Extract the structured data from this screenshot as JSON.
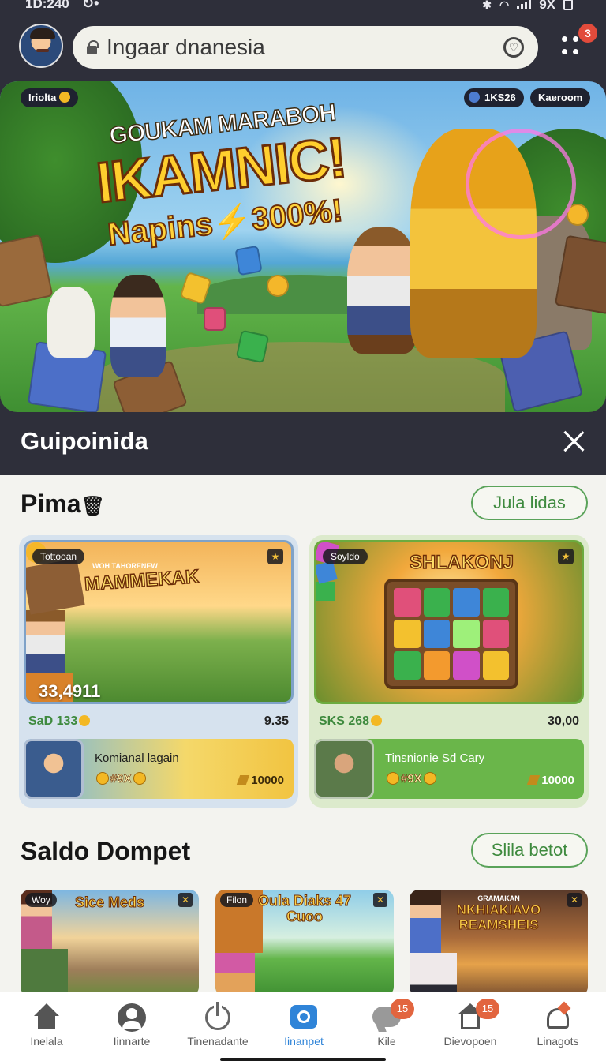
{
  "status_bar": {
    "time": "1D:240",
    "battery": "9X"
  },
  "search": {
    "text": "Ingaar dnanesia"
  },
  "menu": {
    "badge": "3"
  },
  "hero": {
    "chip_left": "Iriolta",
    "chip_right_1": "1KS26",
    "chip_right_2": "Kaeroom",
    "line1": "GOUKAM MARABOH",
    "line2": "IKAMNIC!",
    "line3": "Napins⚡300%!"
  },
  "game_title": "Guipoinida",
  "section1": {
    "title": "Pima",
    "button": "Jula lidas",
    "cards": [
      {
        "tag": "Tottooan",
        "logo_small": "WOH TAHORENEW",
        "logo": "MAMMEKAK",
        "count": "33,4911",
        "meta_left": "SaD 133",
        "meta_right": "9.35",
        "promo_name": "Komianal lagain",
        "promo_mult": "#9X",
        "promo_value": "10000"
      },
      {
        "tag": "Soyldo",
        "logo": "SHLAKONJ",
        "meta_left": "SKS 268",
        "meta_right": "30,00",
        "promo_name": "Tinsnionie Sd Cary",
        "promo_mult": "#9X",
        "promo_value": "10000"
      }
    ]
  },
  "section2": {
    "title": "Saldo Dompet",
    "button": "Slila betot",
    "cards": [
      {
        "tag": "Woy",
        "title": "Sice Meds"
      },
      {
        "tag": "Filon",
        "title": "Oula Diaks 47 Cuoo"
      },
      {
        "tag": "",
        "title": "NKHIAKIAVO REAMSHEIS",
        "title_small": "GRAMAKAN"
      }
    ]
  },
  "nav": {
    "items": [
      {
        "label": "Inelala",
        "icon": "home-icon"
      },
      {
        "label": "Iinnarte",
        "icon": "profile-icon"
      },
      {
        "label": "Tinenadante",
        "icon": "power-icon"
      },
      {
        "label": "Iinanpet",
        "icon": "camera-icon",
        "active": true
      },
      {
        "label": "Kile",
        "icon": "chat-icon",
        "badge": "15"
      },
      {
        "label": "Dievopoen",
        "icon": "house-icon",
        "badge": "15"
      },
      {
        "label": "Linagots",
        "icon": "bell-icon"
      }
    ]
  },
  "colors": {
    "dark_header": "#2e2f3a",
    "accent_green": "#3e8a3e",
    "active_nav": "#2f84d8",
    "badge": "#e2653f"
  }
}
